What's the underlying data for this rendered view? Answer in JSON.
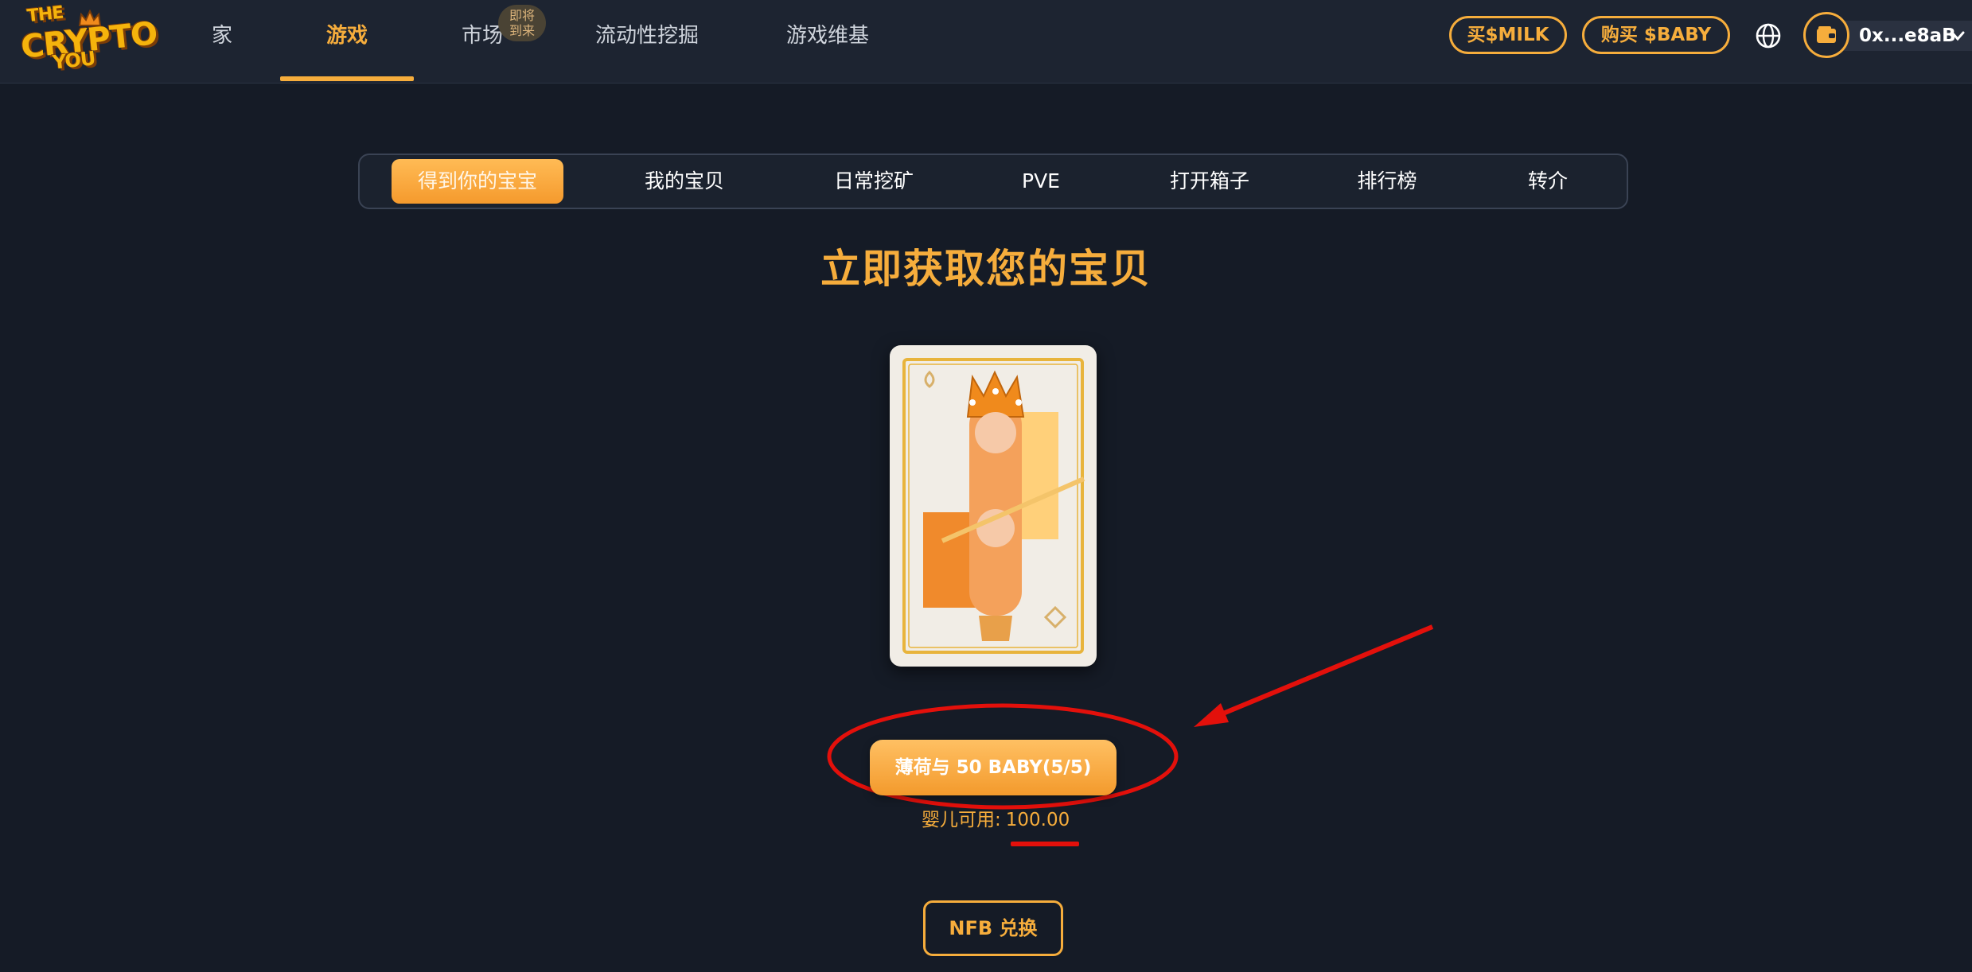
{
  "logo": {
    "line1": "THE",
    "line2": "CRYPTO",
    "line3": "YOU"
  },
  "nav": {
    "items": [
      {
        "label": "家"
      },
      {
        "label": "游戏"
      },
      {
        "label": "市场"
      },
      {
        "label": "流动性挖掘"
      },
      {
        "label": "游戏维基"
      }
    ],
    "active": "游戏",
    "market_badge": "即将到来"
  },
  "header": {
    "buy_milk": "买$MILK",
    "buy_baby": "购买 $BABY",
    "language_icon": "globe-icon",
    "wallet_icon": "wallet-icon",
    "wallet_address": "0x...e8aB"
  },
  "tabs": [
    {
      "label": "得到你的宝宝"
    },
    {
      "label": "我的宝贝"
    },
    {
      "label": "日常挖矿"
    },
    {
      "label": "PVE"
    },
    {
      "label": "打开箱子"
    },
    {
      "label": "排行榜"
    },
    {
      "label": "转介"
    }
  ],
  "active_tab": "得到你的宝宝",
  "main": {
    "title": "立即获取您的宝贝",
    "card_image": "baby-nft-card-image",
    "mint_button": "薄荷与 50 BABY(5/5)",
    "available_label": "婴儿可用:",
    "available_value": "100.00",
    "nfb_button": "NFB 兑换"
  },
  "annotations": {
    "color": "#e3100b",
    "marks": [
      "red-ellipse",
      "red-arrow",
      "red-underline"
    ]
  },
  "colors": {
    "accent": "#f6ad3c",
    "background": "#151b26",
    "topbar": "#1d2431"
  }
}
